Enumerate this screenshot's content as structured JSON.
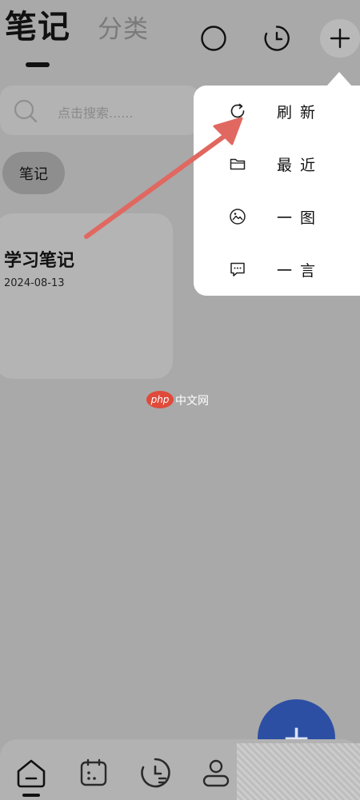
{
  "header": {
    "tab_active": "笔记",
    "tab_inactive": "分类"
  },
  "search": {
    "placeholder": "点击搜索......"
  },
  "filter_chip": {
    "label": "笔记"
  },
  "notes": [
    {
      "title": "学习笔记",
      "date": "2024-08-13"
    }
  ],
  "menu": {
    "items": [
      {
        "label": "刷新",
        "icon": "refresh-icon"
      },
      {
        "label": "最近",
        "icon": "folder-icon"
      },
      {
        "label": "一图",
        "icon": "image-icon"
      },
      {
        "label": "一言",
        "icon": "message-icon"
      }
    ]
  },
  "fab": {
    "label": "+"
  },
  "watermark": {
    "logo": "php",
    "text": "中文网"
  },
  "colors": {
    "background": "#a9a9a9",
    "popup": "#ffffff",
    "fab": "#2d4fa3",
    "arrow": "#e06860",
    "chip": "#8e8e8e"
  }
}
